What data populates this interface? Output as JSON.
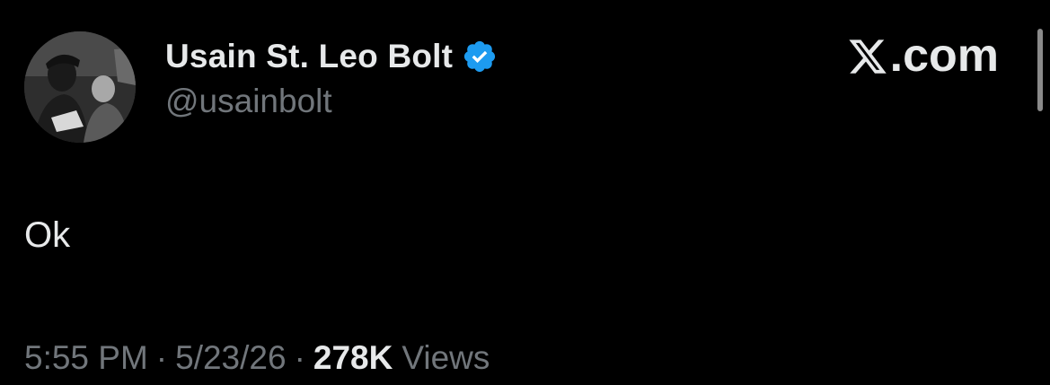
{
  "tweet": {
    "author": {
      "display_name": "Usain St. Leo Bolt",
      "handle": "@usainbolt",
      "verified": true,
      "verified_icon": "verified-badge-icon",
      "avatar": "avatar-photo"
    },
    "brand": {
      "label": ".com",
      "icon": "x-logo-icon"
    },
    "text": "Ok",
    "time": "5:55 PM",
    "separator": "·",
    "date": "5/23/26",
    "views_count": "278K",
    "views_label": "Views"
  },
  "colors": {
    "background": "#000000",
    "primary_text": "#e7e9ea",
    "secondary_text": "#71767b",
    "verified_blue": "#1d9bf0"
  }
}
